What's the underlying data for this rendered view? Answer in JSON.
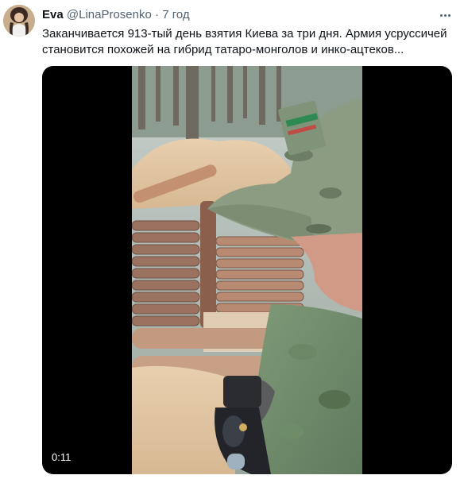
{
  "tweet": {
    "author": {
      "name": "Eva",
      "handle": "@LinaProsenko",
      "separator": "·",
      "time": "7 год"
    },
    "text": "Заканчивается 913-тый день взятия Киева за три дня. Армия усруссичей становится похожей на гибрид татаро-монголов и инко-ацтеков...",
    "more_icon": "more-horizontal-icon",
    "media": {
      "type": "video",
      "duration": "0:11"
    }
  }
}
